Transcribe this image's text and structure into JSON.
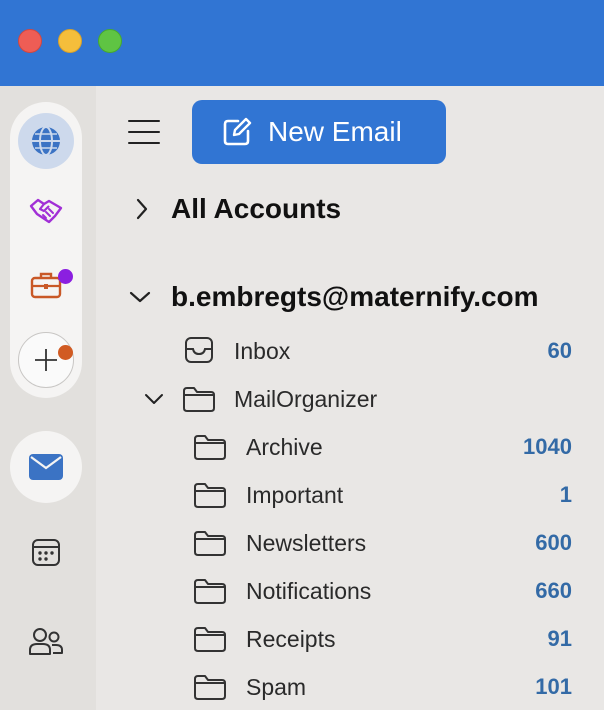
{
  "toolbar": {
    "new_email_label": "New Email"
  },
  "accounts": {
    "all_label": "All Accounts",
    "email": "b.embregts@maternify.com"
  },
  "folders": {
    "inbox": {
      "label": "Inbox",
      "count": "60"
    },
    "group": {
      "label": "MailOrganizer"
    },
    "archive": {
      "label": "Archive",
      "count": "1040"
    },
    "important": {
      "label": "Important",
      "count": "1"
    },
    "newsletters": {
      "label": "Newsletters",
      "count": "600"
    },
    "notifications": {
      "label": "Notifications",
      "count": "660"
    },
    "receipts": {
      "label": "Receipts",
      "count": "91"
    },
    "spam": {
      "label": "Spam",
      "count": "101"
    }
  },
  "colors": {
    "accent": "#3175d3",
    "count": "#336aa6",
    "badge_purple": "#8b1fe0",
    "badge_orange": "#d15b23"
  },
  "icons": [
    "globe-icon",
    "handshake-icon",
    "briefcase-icon",
    "plus-icon",
    "mail-icon",
    "calendar-icon",
    "people-icon",
    "compose-icon",
    "menu-icon",
    "chevron-right-icon",
    "chevron-down-icon",
    "inbox-icon",
    "folder-icon"
  ]
}
